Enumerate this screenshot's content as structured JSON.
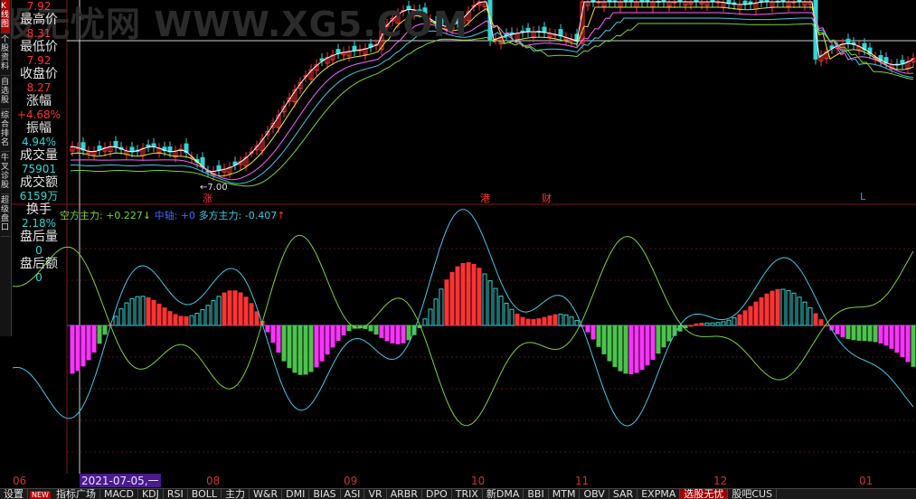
{
  "watermark": "股无忧网 WWW.XG5.COM",
  "side_tabs": [
    {
      "label": "K线图",
      "active": true
    },
    {
      "label": "个股资料",
      "active": false
    },
    {
      "label": "自选股",
      "active": false
    },
    {
      "label": "综合排名",
      "active": false
    },
    {
      "label": "牛叉诊股",
      "active": false
    },
    {
      "label": "超级盘口",
      "active": false
    }
  ],
  "info": {
    "open_value": "7.92",
    "high_label": "最高价",
    "high_value": "8.31",
    "low_label": "最低价",
    "low_value": "7.92",
    "close_label": "收盘价",
    "close_value": "8.27",
    "change_label": "涨幅",
    "change_value": "+4.68%",
    "amplitude_label": "振幅",
    "amplitude_value": "4.94%",
    "volume_label": "成交量",
    "volume_value": "75901",
    "amount_label": "成交额",
    "amount_value": "6159万",
    "turnover_label": "换手",
    "turnover_value": "2.18%",
    "after_vol_label": "盘后量",
    "after_vol_value": "0",
    "after_amt_label": "盘后额",
    "after_amt_value": "0"
  },
  "price_annotation": "←7.00",
  "events": [
    {
      "label": "涨",
      "color": "#ff3333"
    },
    {
      "label": "港",
      "color": "#ff3333"
    },
    {
      "label": "财",
      "color": "#ff3333"
    },
    {
      "label": "L",
      "color": "#3399ff"
    }
  ],
  "indicator": {
    "bear_text": "空方主力: +0.227",
    "bear_arrow": "↓",
    "mid_text": "中轴: +0",
    "bull_text": "多方主力: -0.407",
    "bull_arrow": "↑"
  },
  "x_axis": {
    "labels": [
      "06",
      "07",
      "08",
      "09",
      "10",
      "11",
      "12",
      "01"
    ],
    "highlight": "2021-07-05,一"
  },
  "tabs": [
    {
      "label": "设置",
      "style": "normal"
    },
    {
      "label": "NEW",
      "style": "badge"
    },
    {
      "label": "指标广场",
      "style": "normal"
    },
    {
      "label": "MACD",
      "style": "normal"
    },
    {
      "label": "KDJ",
      "style": "normal"
    },
    {
      "label": "RSI",
      "style": "normal"
    },
    {
      "label": "BOLL",
      "style": "normal"
    },
    {
      "label": "主力",
      "style": "normal"
    },
    {
      "label": "W&R",
      "style": "normal"
    },
    {
      "label": "DMI",
      "style": "normal"
    },
    {
      "label": "BIAS",
      "style": "normal"
    },
    {
      "label": "ASI",
      "style": "normal"
    },
    {
      "label": "VR",
      "style": "normal"
    },
    {
      "label": "ARBR",
      "style": "normal"
    },
    {
      "label": "DPO",
      "style": "normal"
    },
    {
      "label": "TRIX",
      "style": "normal"
    },
    {
      "label": "新DMA",
      "style": "normal"
    },
    {
      "label": "BBI",
      "style": "normal"
    },
    {
      "label": "MTM",
      "style": "normal"
    },
    {
      "label": "OBV",
      "style": "normal"
    },
    {
      "label": "SAR",
      "style": "normal"
    },
    {
      "label": "EXPMA",
      "style": "normal"
    },
    {
      "label": "选股无忧",
      "style": "red"
    },
    {
      "label": "股吧CUS",
      "style": "normal"
    }
  ],
  "colors": {
    "up": "#ff3333",
    "down": "#33d6d6",
    "green": "#4cc44c",
    "magenta": "#ff33ff",
    "bull_line": "#44c8e8",
    "bear_line": "#7ad43a",
    "mid_text": "#3a6bff",
    "grid": "#7a1a1a",
    "date_label": "#cc3333"
  }
}
